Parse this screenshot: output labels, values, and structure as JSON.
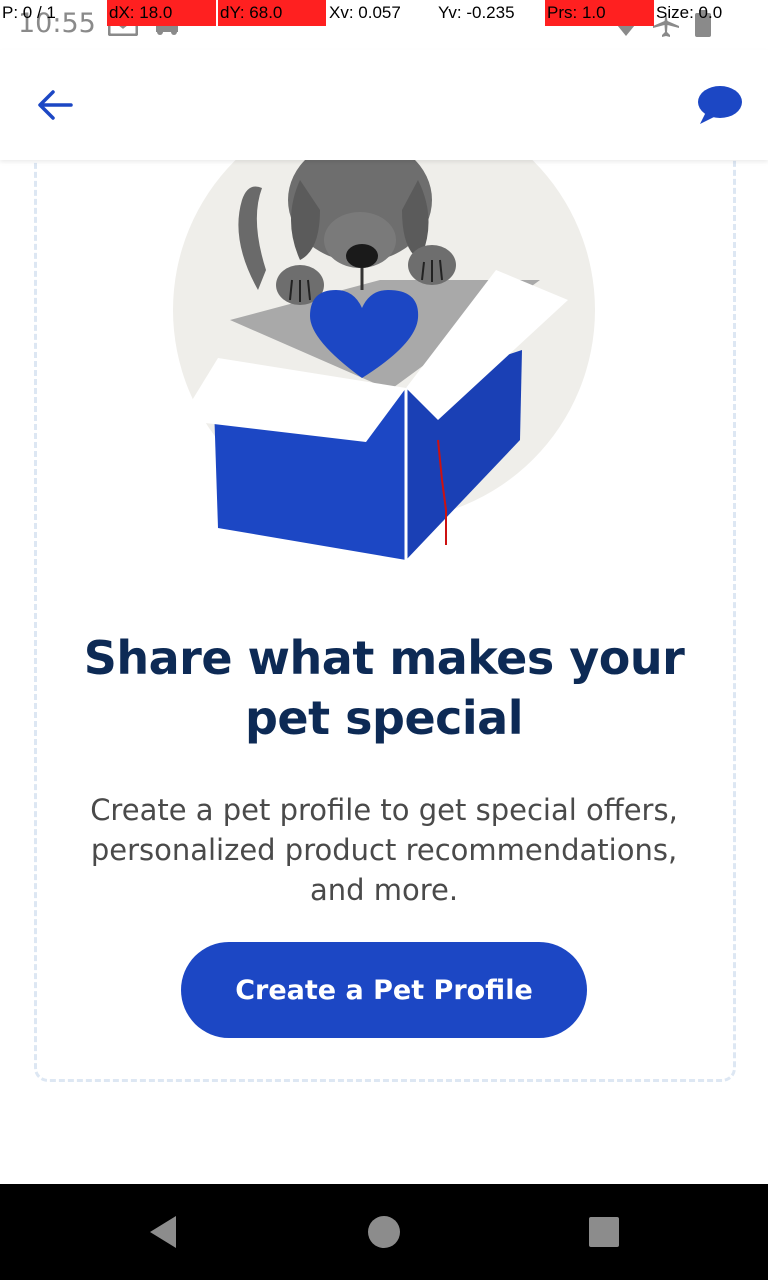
{
  "status_bar": {
    "time": "10:55",
    "icons": [
      "gmail-icon",
      "car-icon",
      "wifi-icon",
      "airplane-icon",
      "battery-icon"
    ]
  },
  "pointer_overlay": {
    "p": "P: 0 / 1",
    "dx": "dX: 18.0",
    "dy": "dY: 68.0",
    "xv": "Xv: 0.057",
    "yv": "Yv: -0.235",
    "prs": "Prs: 1.0",
    "size": "Size: 0.0"
  },
  "app_bar": {
    "back_icon": "arrow-left-icon",
    "chat_icon": "chat-bubble-icon"
  },
  "main": {
    "illustration": "dog-in-gift-box-with-heart",
    "headline": "Share what makes your pet special",
    "description": "Create a pet profile to get special offers, personalized product recommendations, and more.",
    "cta_label": "Create a Pet Profile"
  },
  "nav_bar": {
    "back": "nav-back-icon",
    "home": "nav-home-icon",
    "recents": "nav-recents-icon"
  },
  "colors": {
    "brand_blue": "#1c47c4",
    "headline_navy": "#0d2a55",
    "body_text": "#4a4a4a",
    "card_border": "#dde7f3"
  }
}
